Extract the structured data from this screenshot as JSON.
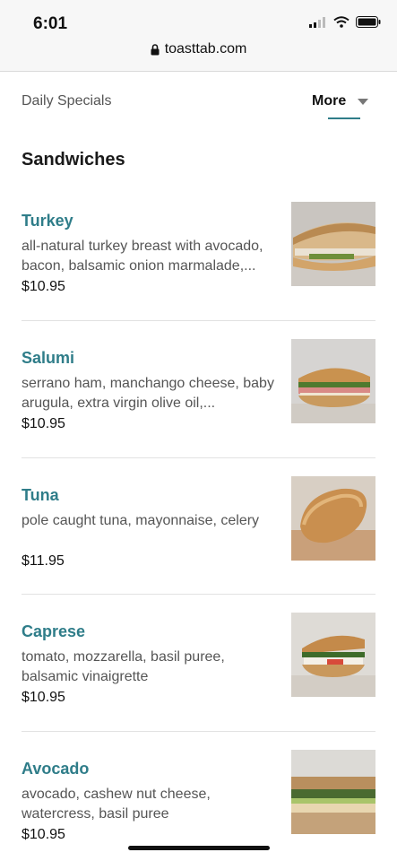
{
  "status_bar": {
    "time": "6:01"
  },
  "browser": {
    "url": "toasttab.com"
  },
  "tabs": {
    "daily_specials": "Daily Specials",
    "more": "More"
  },
  "section": {
    "title": "Sandwiches"
  },
  "items": [
    {
      "name": "Turkey",
      "desc": "all-natural turkey breast with avocado, bacon, balsamic onion marmalade,...",
      "price": "$10.95"
    },
    {
      "name": "Salumi",
      "desc": "serrano ham, manchango cheese, baby arugula, extra virgin olive oil,...",
      "price": "$10.95"
    },
    {
      "name": "Tuna",
      "desc": "pole caught tuna, mayonnaise, celery",
      "price": "$11.95"
    },
    {
      "name": "Caprese",
      "desc": "tomato, mozzarella, basil puree, balsamic vinaigrette",
      "price": "$10.95"
    },
    {
      "name": "Avocado",
      "desc": "avocado, cashew nut cheese, watercress, basil puree",
      "price": "$10.95"
    }
  ],
  "colors": {
    "accent": "#2f7d89",
    "text": "#222222",
    "muted": "#555555"
  }
}
